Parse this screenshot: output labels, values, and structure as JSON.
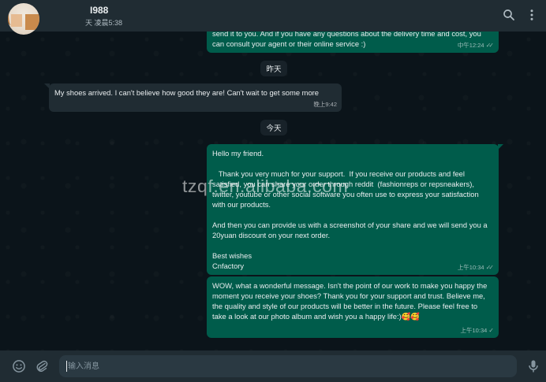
{
  "header": {
    "contact_name": "I988",
    "contact_status": "天 凌晨5:38"
  },
  "icons": {
    "search": "search-icon",
    "menu": "more-vertical-icon",
    "emoji": "emoji-icon",
    "attach": "paperclip-icon",
    "mic": "microphone-icon"
  },
  "messages": [
    {
      "direction": "out",
      "text": "send it to you. And if you have any questions about the delivery time and cost, you can consult your agent or their online service :)",
      "time": "中午12:24"
    },
    {
      "direction": "in",
      "text": "My shoes arrived. I can't believe how good they are! Can't wait to get some more",
      "time": "晚上9:42"
    },
    {
      "direction": "out",
      "text": "Hello my friend.\n\n   Thank you very much for your support.  If you receive our products and feel satisfied, you can share your order through reddit  (fashionreps or repsneakers), twitter, youtube or other social software you often use to express your satisfaction with our products.\n\nAnd then you can provide us with a screenshot of your share and we will send you a 20yuan discount on your next order.\n\nBest wishes\nCnfactory",
      "time": "上午10:34"
    },
    {
      "direction": "out",
      "text": "WOW, what a wonderful message. Isn't the point of our work to make you happy the moment you receive your shoes? Thank you for your support and trust. Believe me, the quality and style of our products will be better in the future. Please feel free to take a look at our photo album and wish you a happy life:)🥰🥰",
      "time": "上午10:34"
    }
  ],
  "date_chips": {
    "yesterday": "昨天",
    "today": "今天"
  },
  "watermark": "tzqf.en.alibaba.com",
  "composer": {
    "placeholder": "输入消息"
  },
  "colors": {
    "header_bg": "#202c33",
    "chat_bg": "#0b141a",
    "outgoing_bubble": "#005c4b",
    "incoming_bubble": "#202c33",
    "input_bg": "#2a3942"
  }
}
